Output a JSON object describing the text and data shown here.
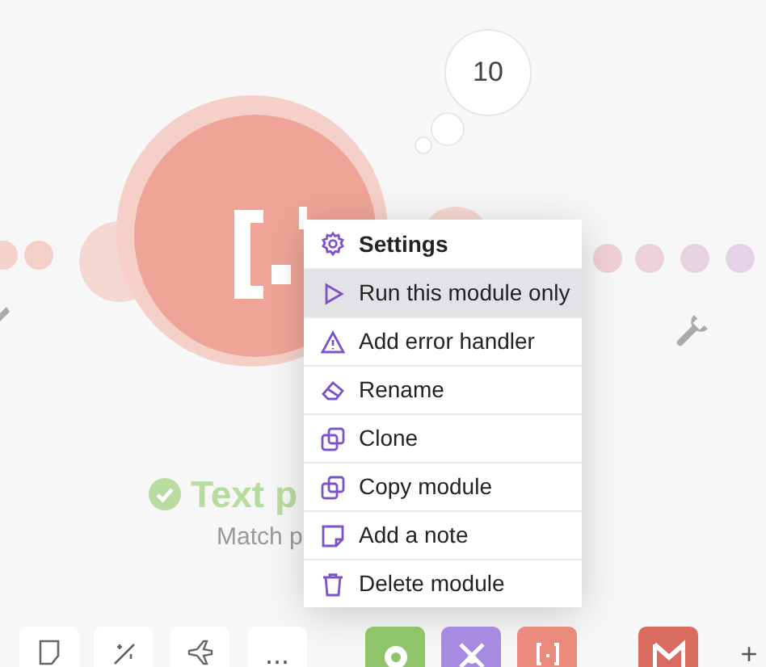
{
  "bubble": {
    "count": "10"
  },
  "module": {
    "title": "Text p",
    "subtitle": "Match p",
    "success": true
  },
  "context_menu": [
    {
      "label": "Settings",
      "kind": "header",
      "selected": false
    },
    {
      "label": "Run this module only",
      "kind": "item",
      "selected": true
    },
    {
      "label": "Add error handler",
      "kind": "item",
      "selected": false
    },
    {
      "label": "Rename",
      "kind": "item",
      "selected": false
    },
    {
      "label": "Clone",
      "kind": "item",
      "selected": false
    },
    {
      "label": "Copy module",
      "kind": "item",
      "selected": false
    },
    {
      "label": "Add a note",
      "kind": "item",
      "selected": false
    },
    {
      "label": "Delete module",
      "kind": "item",
      "selected": false
    }
  ],
  "toolbar": [
    {
      "kind": "tool"
    },
    {
      "kind": "tool"
    },
    {
      "kind": "tool"
    },
    {
      "kind": "text",
      "label": "..."
    },
    {
      "kind": "app",
      "color": "#8fc46a"
    },
    {
      "kind": "app",
      "color": "#a78be0"
    },
    {
      "kind": "app",
      "color": "#e98a7c"
    },
    {
      "kind": "app",
      "color": "#d96b61"
    },
    {
      "kind": "text",
      "label": "+"
    }
  ]
}
